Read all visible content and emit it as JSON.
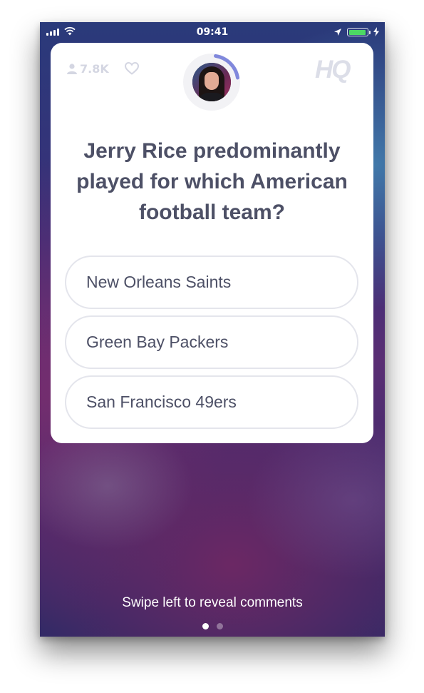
{
  "status_bar": {
    "time": "09:41",
    "battery_level": 0.95,
    "battery_color": "#4cd964",
    "icons": [
      "signal-icon",
      "wifi-icon",
      "location-arrow-icon",
      "battery-icon",
      "charging-bolt-icon"
    ]
  },
  "card": {
    "viewer_count": "7.8K",
    "logo": "HQ",
    "timer_progress": 0.2,
    "timer_color": "#8088dc",
    "question": "Jerry Rice predominantly played for which American football team?",
    "answers": [
      {
        "label": "New Orleans Saints"
      },
      {
        "label": "Green Bay Packers"
      },
      {
        "label": "San Francisco 49ers"
      }
    ]
  },
  "footer": {
    "hint": "Swipe left to reveal comments",
    "page_count": 2,
    "active_page": 1
  }
}
